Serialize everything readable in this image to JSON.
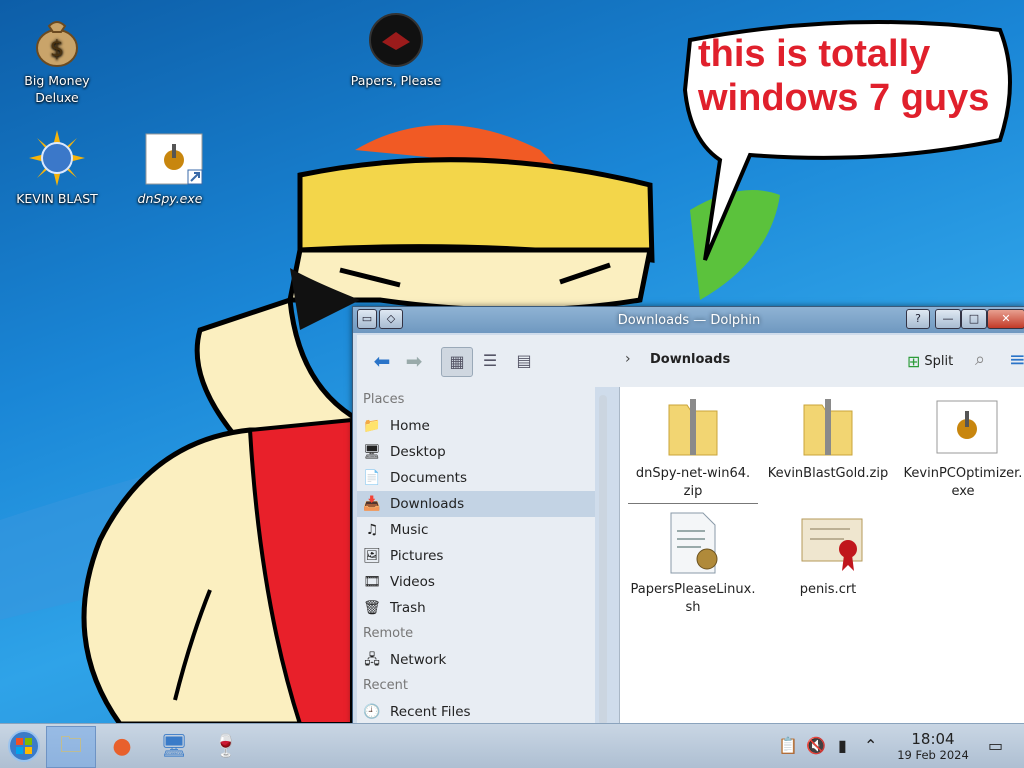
{
  "desktop": {
    "icons": [
      {
        "label_1": "Big Money",
        "label_2": "Deluxe"
      },
      {
        "label": "Papers, Please"
      },
      {
        "label": "KEVIN BLAST"
      },
      {
        "label": "dnSpy.exe"
      }
    ],
    "bubble_line1": "this is totally",
    "bubble_line2": "windows 7 guys"
  },
  "window": {
    "title": "Downloads — Dolphin",
    "buttons": {
      "help": "?",
      "minimize": "—",
      "maximize": "□",
      "close": "✕"
    },
    "toolbar": {
      "breadcrumb": "Downloads",
      "split_label": "Split"
    },
    "places": {
      "section_places": "Places",
      "items": [
        "Home",
        "Desktop",
        "Documents",
        "Downloads",
        "Music",
        "Pictures",
        "Videos",
        "Trash"
      ],
      "section_remote": "Remote",
      "remote_items": [
        "Network"
      ],
      "section_recent": "Recent",
      "recent_items": [
        "Recent Files"
      ],
      "selected": "Downloads"
    },
    "files": [
      {
        "line1": "dnSpy-net-win64.",
        "line2": "zip",
        "icon": "zip-icon"
      },
      {
        "line1": "KevinBlastGold.zip",
        "line2": "",
        "icon": "zip-icon"
      },
      {
        "line1": "KevinPCOptimizer.",
        "line2": "exe",
        "icon": "exe-icon"
      },
      {
        "line1": "PapersPleaseLinux.",
        "line2": "sh",
        "icon": "script-icon"
      },
      {
        "line1": "penis.crt",
        "line2": "",
        "icon": "certificate-icon"
      }
    ]
  },
  "taskbar": {
    "clock_time": "18:04",
    "clock_date": "19 Feb 2024"
  }
}
